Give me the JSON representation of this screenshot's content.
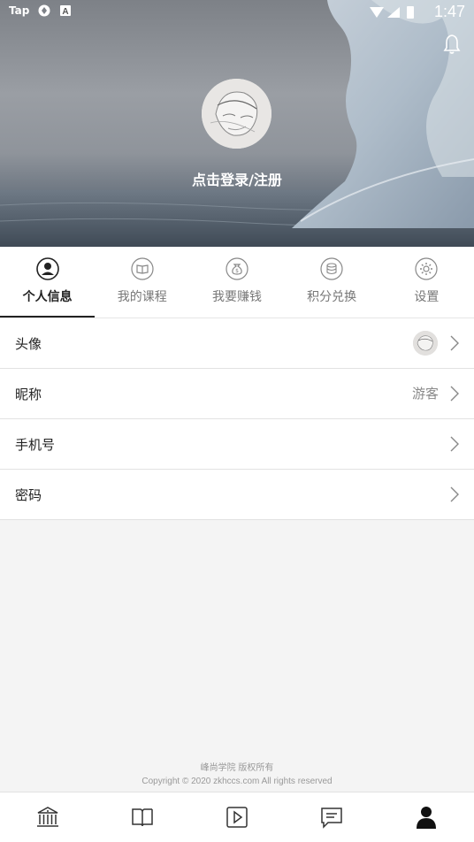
{
  "status_bar": {
    "carrier": "Tap",
    "time": "1:47"
  },
  "header": {
    "login_text": "点击登录/注册"
  },
  "tabs": [
    {
      "label": "个人信息",
      "active": true,
      "icon": "user-circle-icon"
    },
    {
      "label": "我的课程",
      "active": false,
      "icon": "book-icon"
    },
    {
      "label": "我要赚钱",
      "active": false,
      "icon": "money-bag-icon"
    },
    {
      "label": "积分兑换",
      "active": false,
      "icon": "coin-stack-icon"
    },
    {
      "label": "设置",
      "active": false,
      "icon": "gear-icon"
    }
  ],
  "profile_rows": [
    {
      "label": "头像",
      "value": ""
    },
    {
      "label": "昵称",
      "value": "游客"
    },
    {
      "label": "手机号",
      "value": ""
    },
    {
      "label": "密码",
      "value": ""
    }
  ],
  "footer": {
    "line1": "峰尚学院 版权所有",
    "line2": "Copyright © 2020 zkhccs.com All rights reserved"
  },
  "bottom_nav": [
    {
      "icon": "home-building-icon",
      "active": false
    },
    {
      "icon": "open-book-icon",
      "active": false
    },
    {
      "icon": "play-icon",
      "active": false
    },
    {
      "icon": "message-icon",
      "active": false
    },
    {
      "icon": "person-icon",
      "active": true
    }
  ]
}
